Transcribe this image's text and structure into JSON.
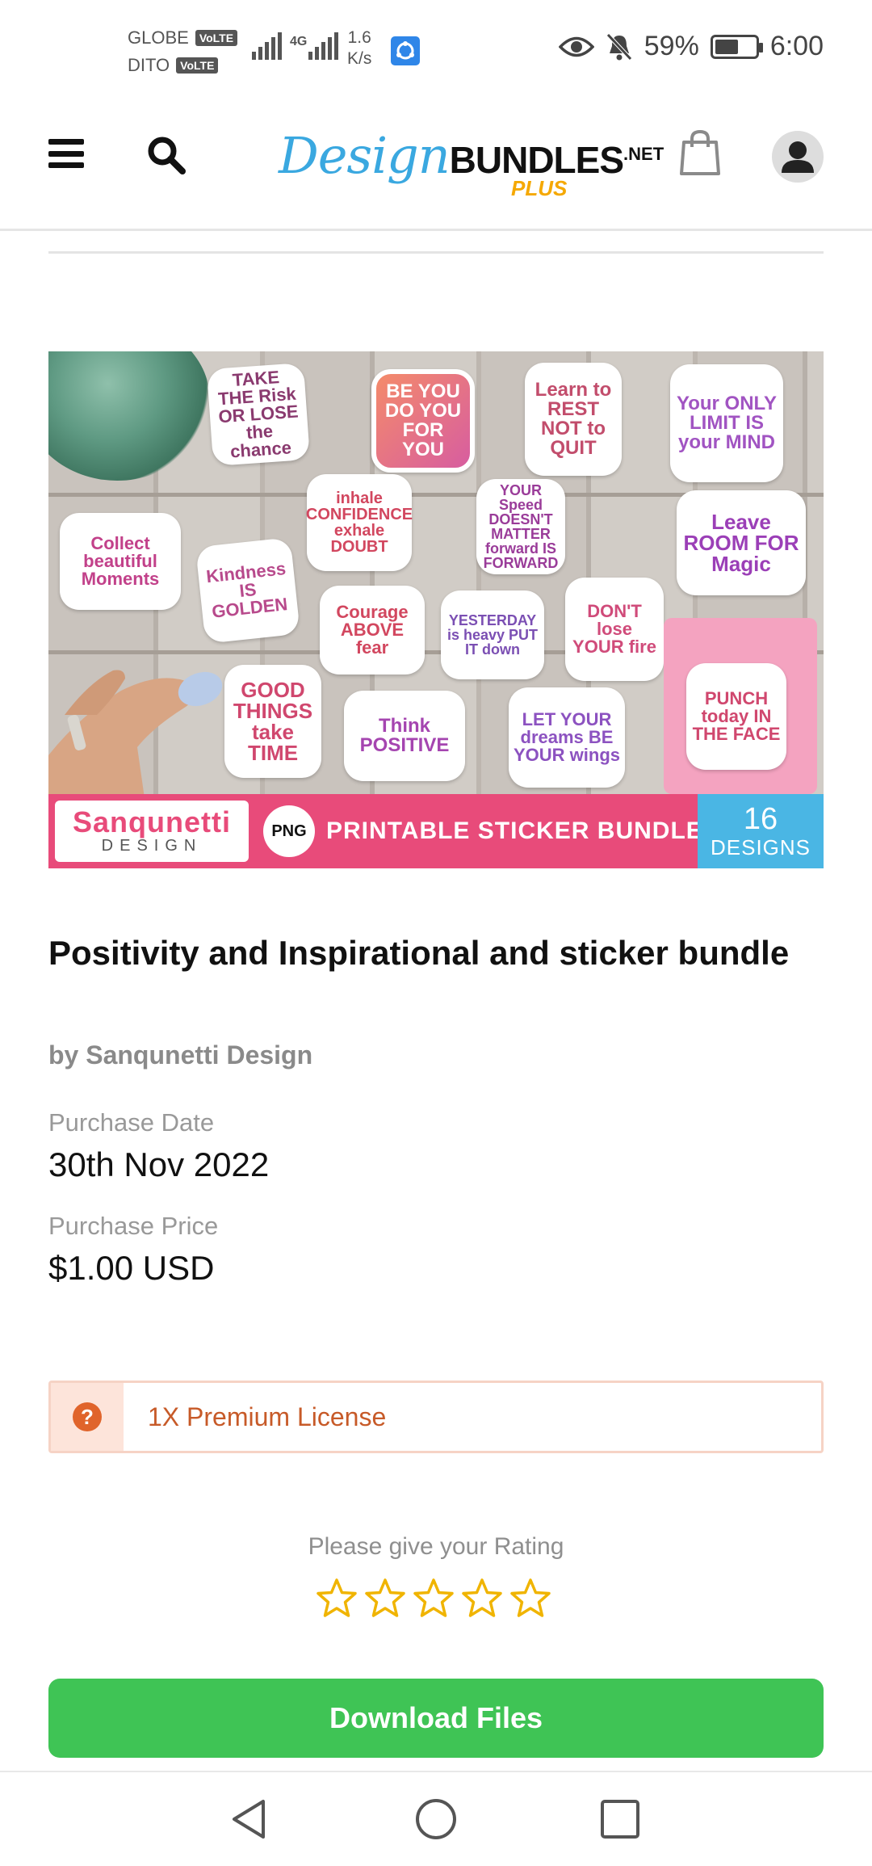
{
  "status_bar": {
    "carrier1": "GLOBE",
    "carrier2": "DITO",
    "volte": "VoLTE",
    "network_type": "4G",
    "speed_value": "1.6",
    "speed_unit": "K/s",
    "battery": "59%",
    "battery_level": 0.59,
    "time": "6:00"
  },
  "header": {
    "logo_design": "Design",
    "logo_bundles": "BUNDLES",
    "logo_net": ".NET",
    "logo_plus": "PLUS"
  },
  "product_image": {
    "stickers": [
      "TAKE THE Risk OR LOSE the chance",
      "BE YOU DO YOU FOR YOU",
      "Learn to REST NOT to QUIT",
      "Your ONLY LIMIT IS your MIND",
      "Collect beautiful Moments",
      "inhale CONFIDENCE exhale DOUBT",
      "YOUR Speed DOESN'T MATTER forward IS FORWARD",
      "Leave ROOM FOR Magic",
      "Kindness IS GOLDEN",
      "Courage ABOVE fear",
      "YESTERDAY is heavy PUT IT down",
      "DON'T lose YOUR fire",
      "GOOD THINGS take TIME",
      "Think POSITIVE",
      "LET YOUR dreams BE YOUR wings",
      "PUNCH today IN THE FACE"
    ],
    "brand_line1": "Sanqunetti",
    "brand_line2": "DESIGN",
    "format_badge": "PNG",
    "banner_title": "PRINTABLE STICKER BUNDLE",
    "count_number": "16",
    "count_label": "DESIGNS"
  },
  "product": {
    "title": "Positivity and Inspirational and sticker bundle",
    "author": "by Sanqunetti Design",
    "purchase_date_label": "Purchase Date",
    "purchase_date": "30th Nov 2022",
    "purchase_price_label": "Purchase Price",
    "purchase_price": "$1.00 USD"
  },
  "license": {
    "icon": "question-circle-icon",
    "label": "1X Premium License"
  },
  "rating": {
    "prompt": "Please give your Rating",
    "max_stars": 5,
    "current": 0
  },
  "actions": {
    "download_label": "Download Files"
  },
  "colors": {
    "brand_blue": "#3aa8e0",
    "plus_gold": "#f5a800",
    "star": "#f0b400",
    "download_green": "#3fc455",
    "license_orange": "#e0642b",
    "banner_pink": "#e84b7a",
    "banner_blue": "#4ab6e4"
  }
}
